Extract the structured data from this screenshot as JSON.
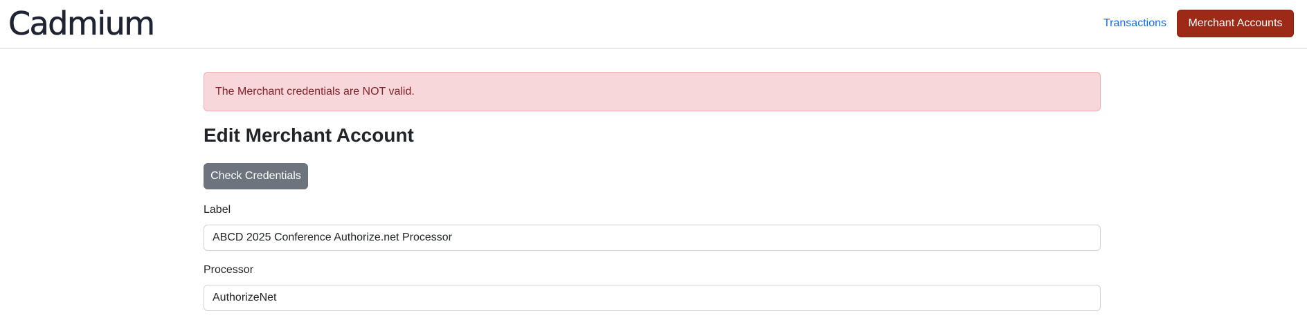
{
  "navbar": {
    "brand": "Cadmium",
    "links": {
      "transactions": "Transactions",
      "merchant_accounts": "Merchant Accounts"
    }
  },
  "alert": {
    "message": "The Merchant credentials are NOT valid."
  },
  "main": {
    "title": "Edit Merchant Account",
    "check_credentials_label": "Check Credentials",
    "fields": {
      "label": {
        "label": "Label",
        "value": "ABCD 2025 Conference Authorize.net Processor"
      },
      "processor": {
        "label": "Processor",
        "value": "AuthorizeNet"
      }
    }
  },
  "colors": {
    "brand_button": "#9c2a17",
    "link": "#0d6efd",
    "alert_bg": "#f8d7da",
    "alert_text": "#842029",
    "secondary_button": "#6c757d"
  }
}
